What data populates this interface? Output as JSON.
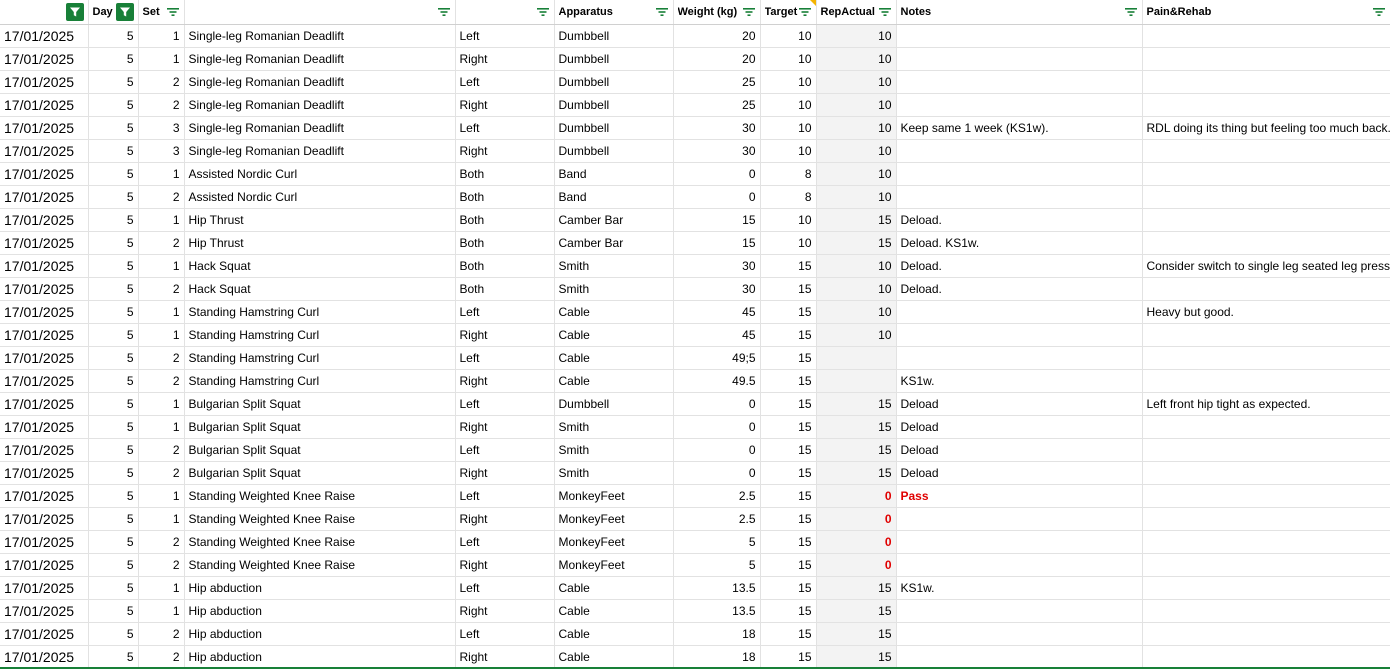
{
  "colors": {
    "filter_active": "#188038",
    "filter_icon": "#188038",
    "zero_value": "#e00000",
    "shaded_column": "#f3f3f3",
    "comment_marker": "#f4b400"
  },
  "headers": [
    {
      "key": "date",
      "label": "",
      "filter": "active",
      "width": 88
    },
    {
      "key": "day",
      "label": "Day",
      "filter": "active",
      "width": 50
    },
    {
      "key": "set",
      "label": "Set",
      "filter": "normal",
      "width": 46
    },
    {
      "key": "exercise",
      "label": "",
      "filter": "normal",
      "width": 271
    },
    {
      "key": "side",
      "label": "",
      "filter": "normal",
      "width": 99
    },
    {
      "key": "apparatus",
      "label": "Apparatus",
      "filter": "normal",
      "width": 119
    },
    {
      "key": "weight",
      "label": "Weight (kg)",
      "filter": "normal",
      "width": 87
    },
    {
      "key": "target",
      "label": "Target",
      "filter": "normal",
      "width": 56
    },
    {
      "key": "repactual",
      "label": "RepActual",
      "filter": "normal",
      "width": 80
    },
    {
      "key": "notes",
      "label": "Notes",
      "filter": "normal",
      "width": 246
    },
    {
      "key": "pain",
      "label": "Pain&Rehab",
      "filter": "normal",
      "width": 248
    }
  ],
  "rows": [
    [
      "17/01/2025",
      "5",
      "1",
      "Single-leg Romanian Deadlift",
      "Left",
      "Dumbbell",
      "20",
      "10",
      "10",
      "",
      ""
    ],
    [
      "17/01/2025",
      "5",
      "1",
      "Single-leg Romanian Deadlift",
      "Right",
      "Dumbbell",
      "20",
      "10",
      "10",
      "",
      ""
    ],
    [
      "17/01/2025",
      "5",
      "2",
      "Single-leg Romanian Deadlift",
      "Left",
      "Dumbbell",
      "25",
      "10",
      "10",
      "",
      ""
    ],
    [
      "17/01/2025",
      "5",
      "2",
      "Single-leg Romanian Deadlift",
      "Right",
      "Dumbbell",
      "25",
      "10",
      "10",
      "",
      ""
    ],
    [
      "17/01/2025",
      "5",
      "3",
      "Single-leg Romanian Deadlift",
      "Left",
      "Dumbbell",
      "30",
      "10",
      "10",
      "Keep same 1 week (KS1w).",
      "RDL doing its thing but feeling too much back."
    ],
    [
      "17/01/2025",
      "5",
      "3",
      "Single-leg Romanian Deadlift",
      "Right",
      "Dumbbell",
      "30",
      "10",
      "10",
      "",
      ""
    ],
    [
      "17/01/2025",
      "5",
      "1",
      "Assisted Nordic Curl",
      "Both",
      "Band",
      "0",
      "8",
      "10",
      "",
      ""
    ],
    [
      "17/01/2025",
      "5",
      "2",
      "Assisted Nordic Curl",
      "Both",
      "Band",
      "0",
      "8",
      "10",
      "",
      ""
    ],
    [
      "17/01/2025",
      "5",
      "1",
      "Hip Thrust",
      "Both",
      "Camber Bar",
      "15",
      "10",
      "15",
      "Deload.",
      ""
    ],
    [
      "17/01/2025",
      "5",
      "2",
      "Hip Thrust",
      "Both",
      "Camber Bar",
      "15",
      "10",
      "15",
      "Deload. KS1w.",
      ""
    ],
    [
      "17/01/2025",
      "5",
      "1",
      "Hack Squat",
      "Both",
      "Smith",
      "30",
      "15",
      "10",
      "Deload.",
      "Consider switch to single leg seated leg press"
    ],
    [
      "17/01/2025",
      "5",
      "2",
      "Hack Squat",
      "Both",
      "Smith",
      "30",
      "15",
      "10",
      "Deload.",
      ""
    ],
    [
      "17/01/2025",
      "5",
      "1",
      "Standing Hamstring Curl",
      "Left",
      "Cable",
      "45",
      "15",
      "10",
      "",
      "Heavy but good."
    ],
    [
      "17/01/2025",
      "5",
      "1",
      "Standing Hamstring Curl",
      "Right",
      "Cable",
      "45",
      "15",
      "10",
      "",
      ""
    ],
    [
      "17/01/2025",
      "5",
      "2",
      "Standing Hamstring Curl",
      "Left",
      "Cable",
      "49;5",
      "15",
      "",
      "",
      ""
    ],
    [
      "17/01/2025",
      "5",
      "2",
      "Standing Hamstring Curl",
      "Right",
      "Cable",
      "49.5",
      "15",
      "",
      "KS1w.",
      ""
    ],
    [
      "17/01/2025",
      "5",
      "1",
      "Bulgarian Split Squat",
      "Left",
      "Dumbbell",
      "0",
      "15",
      "15",
      "Deload",
      "Left front hip tight as expected."
    ],
    [
      "17/01/2025",
      "5",
      "1",
      "Bulgarian Split Squat",
      "Right",
      "Smith",
      "0",
      "15",
      "15",
      "Deload",
      ""
    ],
    [
      "17/01/2025",
      "5",
      "2",
      "Bulgarian Split Squat",
      "Left",
      "Smith",
      "0",
      "15",
      "15",
      "Deload",
      ""
    ],
    [
      "17/01/2025",
      "5",
      "2",
      "Bulgarian Split Squat",
      "Right",
      "Smith",
      "0",
      "15",
      "15",
      "Deload",
      ""
    ],
    [
      "17/01/2025",
      "5",
      "1",
      "Standing Weighted Knee Raise",
      "Left",
      "MonkeyFeet",
      "2.5",
      "15",
      "0",
      "Pass",
      ""
    ],
    [
      "17/01/2025",
      "5",
      "1",
      "Standing Weighted Knee Raise",
      "Right",
      "MonkeyFeet",
      "2.5",
      "15",
      "0",
      "",
      ""
    ],
    [
      "17/01/2025",
      "5",
      "2",
      "Standing Weighted Knee Raise",
      "Left",
      "MonkeyFeet",
      "5",
      "15",
      "0",
      "",
      ""
    ],
    [
      "17/01/2025",
      "5",
      "2",
      "Standing Weighted Knee Raise",
      "Right",
      "MonkeyFeet",
      "5",
      "15",
      "0",
      "",
      ""
    ],
    [
      "17/01/2025",
      "5",
      "1",
      "Hip abduction",
      "Left",
      "Cable",
      "13.5",
      "15",
      "15",
      "KS1w.",
      ""
    ],
    [
      "17/01/2025",
      "5",
      "1",
      "Hip abduction",
      "Right",
      "Cable",
      "13.5",
      "15",
      "15",
      "",
      ""
    ],
    [
      "17/01/2025",
      "5",
      "2",
      "Hip abduction",
      "Left",
      "Cable",
      "18",
      "15",
      "15",
      "",
      ""
    ],
    [
      "17/01/2025",
      "5",
      "2",
      "Hip abduction",
      "Right",
      "Cable",
      "18",
      "15",
      "15",
      "",
      ""
    ]
  ]
}
